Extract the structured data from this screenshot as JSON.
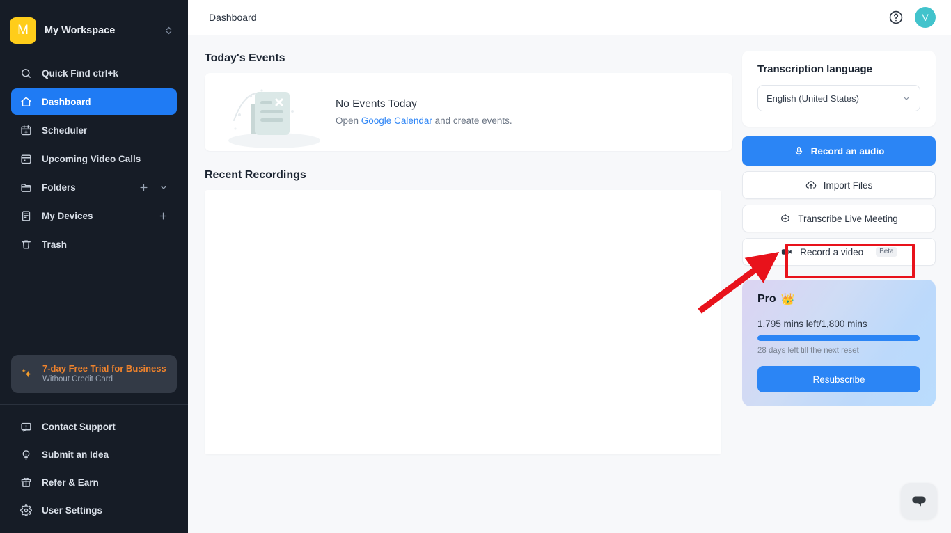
{
  "sidebar": {
    "workspace": {
      "initial": "M",
      "name": "My Workspace",
      "logo_color": "#ffcd1a"
    },
    "items": [
      {
        "label": "Quick Find ctrl+k",
        "icon": "search-icon",
        "active": false
      },
      {
        "label": "Dashboard",
        "icon": "home-icon",
        "active": true
      },
      {
        "label": "Scheduler",
        "icon": "calendar-plus-icon",
        "active": false
      },
      {
        "label": "Upcoming Video Calls",
        "icon": "calendar-icon",
        "active": false
      },
      {
        "label": "Folders",
        "icon": "folder-icon",
        "active": false
      },
      {
        "label": "My Devices",
        "icon": "device-icon",
        "active": false
      },
      {
        "label": "Trash",
        "icon": "trash-icon",
        "active": false
      }
    ],
    "trial": {
      "title": "7-day Free Trial for Business",
      "subtitle": "Without Credit Card",
      "accent": "#f0832c"
    },
    "bottom_items": [
      {
        "label": "Contact Support",
        "icon": "message-icon"
      },
      {
        "label": "Submit an Idea",
        "icon": "lightbulb-icon"
      },
      {
        "label": "Refer & Earn",
        "icon": "gift-icon"
      },
      {
        "label": "User Settings",
        "icon": "gear-icon"
      }
    ]
  },
  "topbar": {
    "title": "Dashboard",
    "help_icon": "help-circle-icon",
    "avatar_initial": "V",
    "avatar_color": "#42c3cc"
  },
  "content": {
    "events_heading": "Today's Events",
    "events_empty_title": "No Events Today",
    "events_empty_prefix": "Open ",
    "events_empty_link": "Google Calendar",
    "events_empty_suffix": " and create events.",
    "recent_heading": "Recent Recordings"
  },
  "right_panel": {
    "transcription_title": "Transcription language",
    "language_value": "English (United States)",
    "actions": [
      {
        "label": "Record an audio",
        "icon": "microphone-icon",
        "style": "primary",
        "badge": ""
      },
      {
        "label": "Import Files",
        "icon": "upload-cloud-icon",
        "style": "default",
        "badge": ""
      },
      {
        "label": "Transcribe Live Meeting",
        "icon": "robot-icon",
        "style": "default",
        "badge": ""
      },
      {
        "label": "Record a video",
        "icon": "video-camera-icon",
        "style": "default",
        "badge": "Beta"
      }
    ],
    "pro": {
      "title": "Pro",
      "emoji": "👑",
      "minutes_text": "1,795 mins left/1,800 mins",
      "progress_percent": 99.7,
      "reset_text": "28 days left till the next reset",
      "resubscribe_label": "Resubscribe",
      "accent": "#2b85f5"
    }
  },
  "annotations": {
    "highlight_target": "Record a video",
    "highlight_color": "#e8121b",
    "arrow_color": "#e8121b"
  },
  "chat": {
    "icon": "chat-bubble-icon"
  }
}
